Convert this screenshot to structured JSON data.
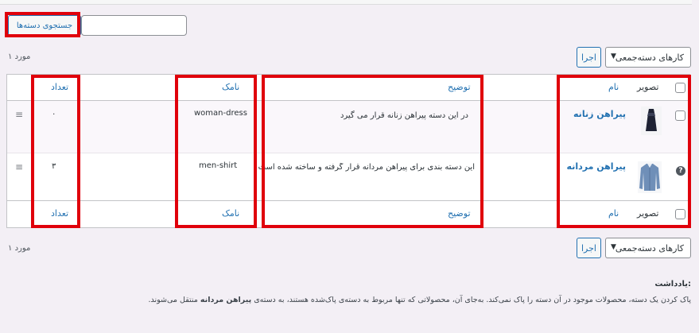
{
  "search": {
    "button_label": "جستجوی دسته‌ها",
    "value": ""
  },
  "top": {
    "count": "۱ مورد",
    "bulk_label": "کارهای دسته‌جمعی",
    "apply_label": "اجرا"
  },
  "bottom": {
    "count": "۱ مورد",
    "bulk_label": "کارهای دسته‌جمعی",
    "apply_label": "اجرا"
  },
  "table": {
    "headers": {
      "image": "تصویر",
      "name": "نام",
      "description": "توضیح",
      "slug": "نامک",
      "count": "تعداد"
    },
    "rows": [
      {
        "name": "پیراهن زنانه",
        "description": "در این دسته پیراهن زنانه قرار می گیرد",
        "slug": "woman-dress",
        "count": "۰",
        "thumb_icon": "dress-image"
      },
      {
        "name": "پیراهن مردانه",
        "description": "این دسته بندی برای پیراهن مردانه قرار گرفته و ساخته شده است",
        "slug": "men-shirt",
        "count": "۳",
        "thumb_icon": "shirt-image"
      }
    ]
  },
  "note": {
    "title": "یادداشت:",
    "text_before": "پاک کردن یک دسته، محصولات موجود در آن دسته را پاک نمی‌کند. به‌جای آن، محصولاتی که تنها مربوط به دسته‌ی پاک‌شده هستند، به دسته‌ی",
    "default_category": "پیراهن مردانه",
    "text_after": "منتقل می‌شوند."
  },
  "colors": {
    "accent": "#2271b1",
    "highlight": "#e0000b"
  }
}
